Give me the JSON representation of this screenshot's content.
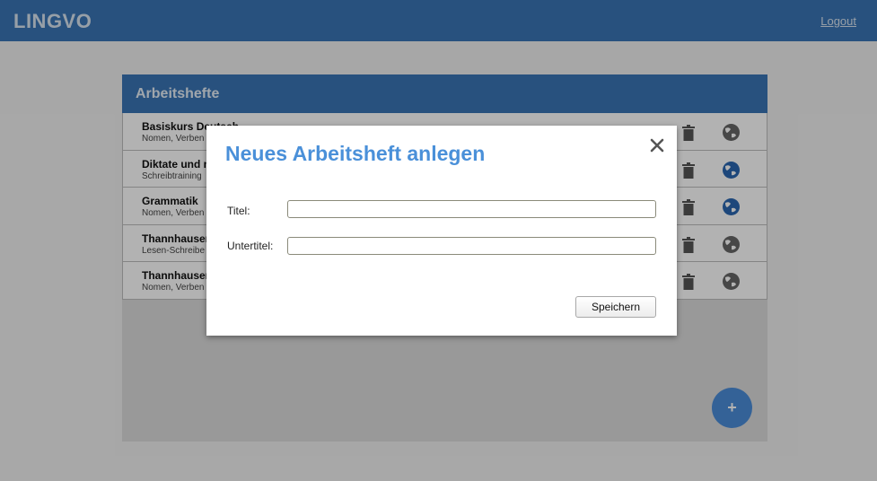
{
  "header": {
    "brand": "LINGVO",
    "logout_label": "Logout"
  },
  "panel": {
    "title": "Arbeitshefte",
    "rows": [
      {
        "title": "Basiskurs Deutsch",
        "subtitle": "Nomen, Verben",
        "globe_color": "#666666"
      },
      {
        "title": "Diktate und m",
        "subtitle": "Schreibtraining",
        "globe_color": "#2a66b0"
      },
      {
        "title": "Grammatik",
        "subtitle": "Nomen, Verben",
        "globe_color": "#2a66b0"
      },
      {
        "title": "Thannhausen",
        "subtitle": "Lesen-Schreibe",
        "globe_color": "#666666"
      },
      {
        "title": "Thannhausen",
        "subtitle": "Nomen, Verben",
        "globe_color": "#666666"
      }
    ],
    "add_label": "+"
  },
  "modal": {
    "title": "Neues Arbeitsheft anlegen",
    "fields": [
      {
        "label": "Titel:",
        "value": "",
        "placeholder": ""
      },
      {
        "label": "Untertitel:",
        "value": "",
        "placeholder": ""
      }
    ],
    "save_label": "Speichern"
  },
  "colors": {
    "brand_blue": "#3a75b5",
    "modal_title": "#4a90d9",
    "fab": "#4b8dd9"
  },
  "icons": [
    "trash-icon",
    "globe-icon",
    "close-icon"
  ]
}
